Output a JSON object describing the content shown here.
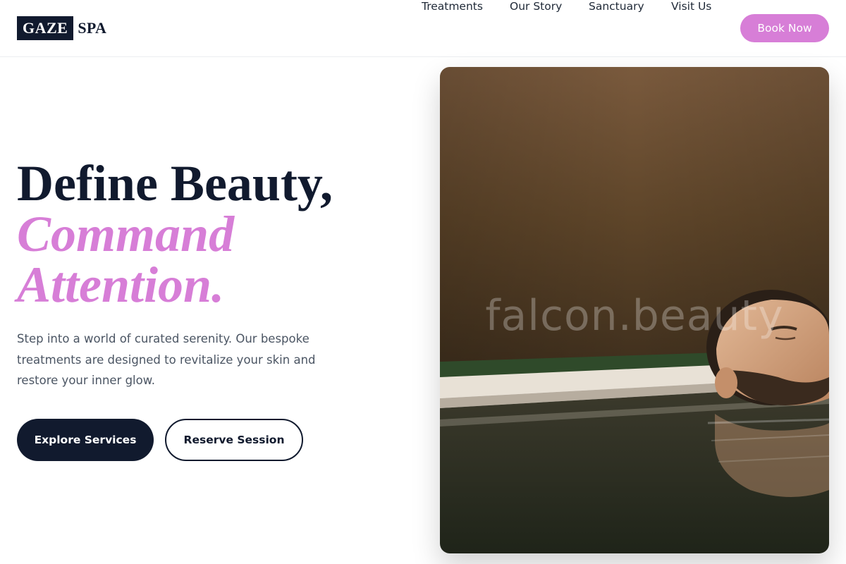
{
  "brand": {
    "logo_box": "GAZE",
    "logo_text": "SPA"
  },
  "nav": {
    "items": [
      {
        "label": "Treatments"
      },
      {
        "label": "Our Story"
      },
      {
        "label": "Sanctuary"
      },
      {
        "label": "Visit Us"
      }
    ],
    "cta": "Book Now"
  },
  "hero": {
    "title_line1": "Define Beauty,",
    "title_line2": "Command",
    "title_line3": "Attention.",
    "description": "Step into a world of curated serenity. Our bespoke treatments are designed to revitalize your skin and restore your inner glow.",
    "primary_button": "Explore Services",
    "secondary_button": "Reserve Session"
  },
  "image": {
    "watermark": "falcon.beauty"
  },
  "colors": {
    "accent": "#d77ed7",
    "dark": "#111a2e",
    "body_text": "#4b5563"
  }
}
